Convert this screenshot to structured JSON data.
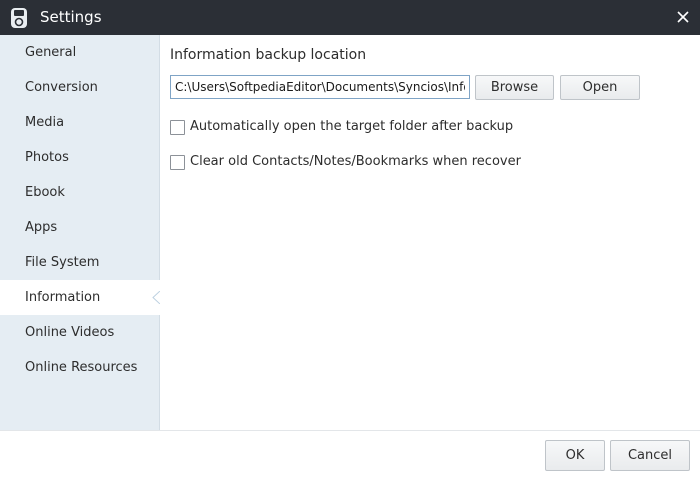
{
  "window": {
    "title": "Settings"
  },
  "sidebar": {
    "items": [
      {
        "label": "General"
      },
      {
        "label": "Conversion"
      },
      {
        "label": "Media"
      },
      {
        "label": "Photos"
      },
      {
        "label": "Ebook"
      },
      {
        "label": "Apps"
      },
      {
        "label": "File System"
      },
      {
        "label": "Information"
      },
      {
        "label": "Online Videos"
      },
      {
        "label": "Online Resources"
      }
    ],
    "active": "Information"
  },
  "main": {
    "section_title": "Information backup location",
    "path_value": "C:\\Users\\SoftpediaEditor\\Documents\\Syncios\\Information",
    "browse_label": "Browse",
    "open_label": "Open",
    "options": [
      {
        "label": "Automatically open the target folder after backup",
        "checked": false
      },
      {
        "label": "Clear old Contacts/Notes/Bookmarks when recover",
        "checked": false
      }
    ]
  },
  "footer": {
    "ok_label": "OK",
    "cancel_label": "Cancel"
  },
  "icons": {
    "app": "syncios-app-icon",
    "close": "close-icon",
    "active_indicator": "active-pointer-icon"
  },
  "colors": {
    "titlebar": "#2b2f36",
    "sidebar_bg": "#e5edf3",
    "active_item_bg": "#ffffff",
    "input_border": "#7fa4c6"
  }
}
